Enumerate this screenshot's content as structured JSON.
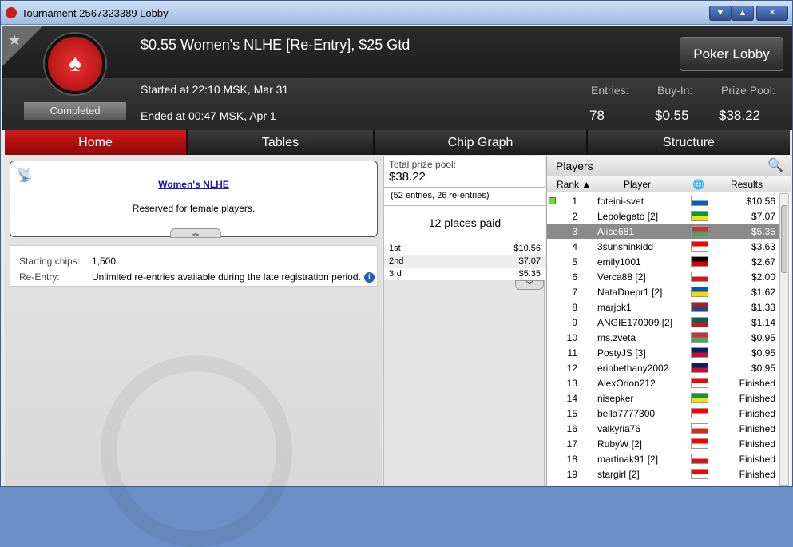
{
  "window": {
    "title": "Tournament 2567323389 Lobby"
  },
  "header": {
    "tournament_title": "$0.55 Women's NLHE [Re-Entry], $25 Gtd",
    "status": "Completed",
    "started": "Started at 22:10 MSK, Mar 31",
    "ended": "Ended at 00:47 MSK, Apr 1",
    "poker_lobby_label": "Poker Lobby",
    "stats": {
      "entries_label": "Entries:",
      "entries_value": "78",
      "buyin_label": "Buy-In:",
      "buyin_value": "$0.55",
      "prizepool_label": "Prize Pool:",
      "prizepool_value": "$38.22"
    }
  },
  "tabs": [
    "Home",
    "Tables",
    "Chip Graph",
    "Structure"
  ],
  "info": {
    "title": "Women's NLHE",
    "description": "Reserved for female players."
  },
  "details": {
    "starting_chips_label": "Starting chips:",
    "starting_chips_value": "1,500",
    "reentry_label": "Re-Entry:",
    "reentry_value": "Unlimited re-entries available during the late registration period."
  },
  "prize": {
    "total_label": "Total prize pool:",
    "total_value": "$38.22",
    "entries_note": "(52 entries, 26 re-entries)",
    "places_paid": "12 places paid",
    "payouts": [
      {
        "place": "1st",
        "amount": "$10.56"
      },
      {
        "place": "2nd",
        "amount": "$7.07"
      },
      {
        "place": "3rd",
        "amount": "$5.35"
      }
    ]
  },
  "players": {
    "title": "Players",
    "columns": {
      "rank": "Rank",
      "player": "Player",
      "results": "Results"
    },
    "rows": [
      {
        "rank": "1",
        "name": "foteini-svet",
        "result": "$10.56",
        "flag": [
          "#ffffff",
          "#0d5eaf"
        ]
      },
      {
        "rank": "2",
        "name": "Lepolegato [2]",
        "result": "$7.07",
        "flag": [
          "#009b3a",
          "#fedf00"
        ]
      },
      {
        "rank": "3",
        "name": "Alice681",
        "result": "$5.35",
        "flag": [
          "#c8313e",
          "#4aa657"
        ]
      },
      {
        "rank": "4",
        "name": "3sunshinkidd",
        "result": "$3.63",
        "flag": [
          "#ff0000",
          "#ffffff"
        ]
      },
      {
        "rank": "5",
        "name": "emily1001",
        "result": "$2.67",
        "flag": [
          "#000000",
          "#dd0000"
        ]
      },
      {
        "rank": "6",
        "name": "Verca88 [2]",
        "result": "$2.00",
        "flag": [
          "#ffffff",
          "#d7141a"
        ]
      },
      {
        "rank": "7",
        "name": "NataDnepr1 [2]",
        "result": "$1.62",
        "flag": [
          "#0057b7",
          "#ffd700"
        ]
      },
      {
        "rank": "8",
        "name": "marjok1",
        "result": "$1.33",
        "flag": [
          "#ae1c28",
          "#21468b"
        ]
      },
      {
        "rank": "9",
        "name": "ANGIE170909 [2]",
        "result": "$1.14",
        "flag": [
          "#006847",
          "#ce1126"
        ]
      },
      {
        "rank": "10",
        "name": "ms.zveta",
        "result": "$0.95",
        "flag": [
          "#c8313e",
          "#4aa657"
        ]
      },
      {
        "rank": "11",
        "name": "PostyJS [3]",
        "result": "$0.95",
        "flag": [
          "#012169",
          "#c8102e"
        ]
      },
      {
        "rank": "12",
        "name": "erinbethany2002",
        "result": "$0.95",
        "flag": [
          "#012169",
          "#c8102e"
        ]
      },
      {
        "rank": "13",
        "name": "AlexOrion212",
        "result": "Finished",
        "flag": [
          "#ff0000",
          "#ffffff"
        ]
      },
      {
        "rank": "14",
        "name": "nisepker",
        "result": "Finished",
        "flag": [
          "#009b3a",
          "#fedf00"
        ]
      },
      {
        "rank": "15",
        "name": "bella7777300",
        "result": "Finished",
        "flag": [
          "#ff0000",
          "#ffffff"
        ]
      },
      {
        "rank": "16",
        "name": "valkyria76",
        "result": "Finished",
        "flag": [
          "#ffffff",
          "#d52b1e"
        ]
      },
      {
        "rank": "17",
        "name": "RubyW [2]",
        "result": "Finished",
        "flag": [
          "#ff0000",
          "#ffffff"
        ]
      },
      {
        "rank": "18",
        "name": "martinak91 [2]",
        "result": "Finished",
        "flag": [
          "#ffffff",
          "#d7141a"
        ]
      },
      {
        "rank": "19",
        "name": "stargirl [2]",
        "result": "Finished",
        "flag": [
          "#ff0000",
          "#ffffff"
        ]
      }
    ]
  }
}
